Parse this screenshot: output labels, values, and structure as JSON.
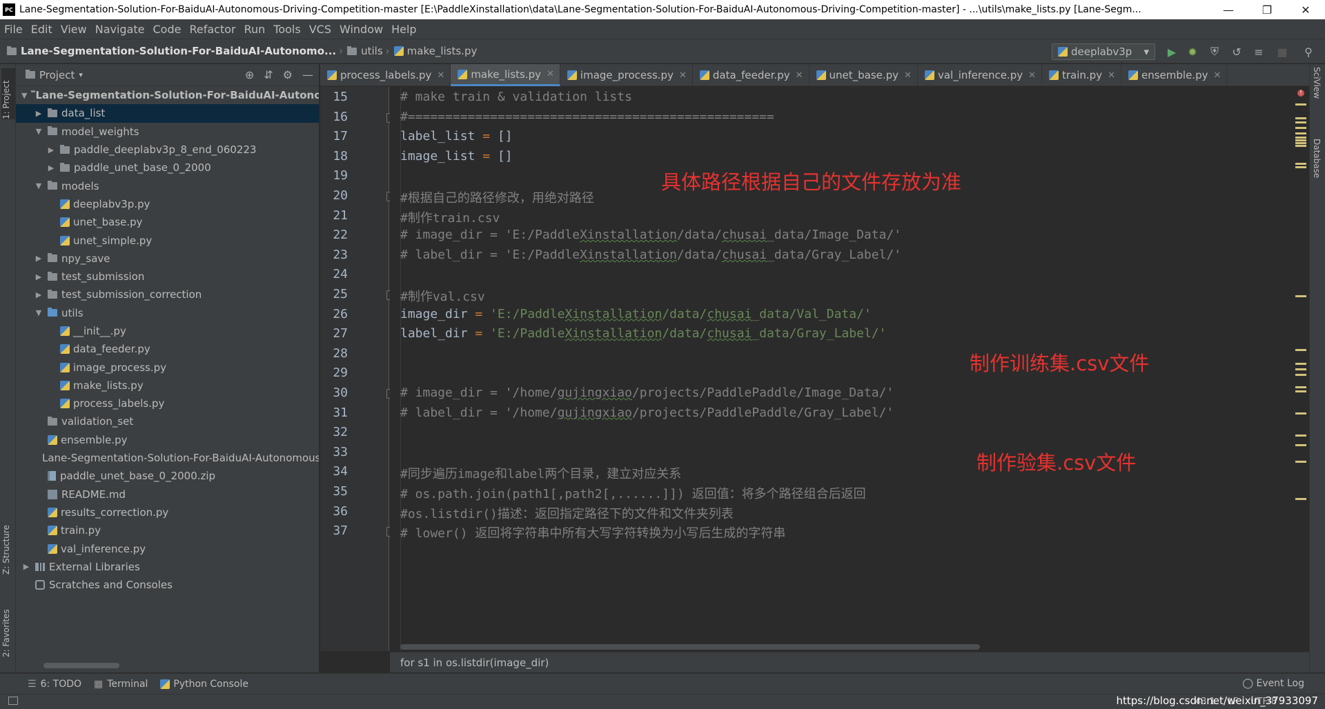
{
  "window": {
    "app_icon": "PC",
    "title": "Lane-Segmentation-Solution-For-BaiduAI-Autonomous-Driving-Competition-master [E:\\PaddleXinstallation\\data\\Lane-Segmentation-Solution-For-BaiduAI-Autonomous-Driving-Competition-master] - ...\\utils\\make_lists.py [Lane-Segm..."
  },
  "menu": [
    "File",
    "Edit",
    "View",
    "Navigate",
    "Code",
    "Refactor",
    "Run",
    "Tools",
    "VCS",
    "Window",
    "Help"
  ],
  "navbar": {
    "project": "Lane-Segmentation-Solution-For-BaiduAI-Autonomo...",
    "folder": "utils",
    "file": "make_lists.py",
    "run_config": "deeplabv3p"
  },
  "left_strip": {
    "project_tab": "1: Project",
    "structure_tab": "Z: Structure",
    "favorites_tab": "2: Favorites"
  },
  "right_strip": {
    "sciview_tab": "SciView",
    "database_tab": "Database"
  },
  "project_panel": {
    "header": "Project",
    "tree": [
      {
        "label": "Lane-Segmentation-Solution-For-BaiduAI-Autonomous-Driving-Competition-master",
        "icon": "folder",
        "level": 0,
        "arrow": "▼",
        "bold": true
      },
      {
        "label": "data_list",
        "icon": "folder",
        "level": 1,
        "arrow": "▶",
        "selected": true
      },
      {
        "label": "model_weights",
        "icon": "folder",
        "level": 1,
        "arrow": "▼"
      },
      {
        "label": "paddle_deeplabv3p_8_end_060223",
        "icon": "folder",
        "level": 2,
        "arrow": "▶"
      },
      {
        "label": "paddle_unet_base_0_2000",
        "icon": "folder",
        "level": 2,
        "arrow": "▶"
      },
      {
        "label": "models",
        "icon": "folder",
        "level": 1,
        "arrow": "▼"
      },
      {
        "label": "deeplabv3p.py",
        "icon": "py",
        "level": 2,
        "arrow": ""
      },
      {
        "label": "unet_base.py",
        "icon": "py",
        "level": 2,
        "arrow": ""
      },
      {
        "label": "unet_simple.py",
        "icon": "py",
        "level": 2,
        "arrow": ""
      },
      {
        "label": "npy_save",
        "icon": "folder",
        "level": 1,
        "arrow": "▶"
      },
      {
        "label": "test_submission",
        "icon": "folder",
        "level": 1,
        "arrow": "▶"
      },
      {
        "label": "test_submission_correction",
        "icon": "folder",
        "level": 1,
        "arrow": "▶"
      },
      {
        "label": "utils",
        "icon": "folder-blue",
        "level": 1,
        "arrow": "▼"
      },
      {
        "label": "__init__.py",
        "icon": "py",
        "level": 2,
        "arrow": ""
      },
      {
        "label": "data_feeder.py",
        "icon": "py",
        "level": 2,
        "arrow": ""
      },
      {
        "label": "image_process.py",
        "icon": "py",
        "level": 2,
        "arrow": ""
      },
      {
        "label": "make_lists.py",
        "icon": "py",
        "level": 2,
        "arrow": ""
      },
      {
        "label": "process_labels.py",
        "icon": "py",
        "level": 2,
        "arrow": ""
      },
      {
        "label": "validation_set",
        "icon": "folder",
        "level": 1,
        "arrow": ""
      },
      {
        "label": "ensemble.py",
        "icon": "py",
        "level": 1,
        "arrow": ""
      },
      {
        "label": "Lane-Segmentation-Solution-For-BaiduAI-Autonomous-Driving-Competition-master.iml",
        "icon": "file",
        "level": 1,
        "arrow": ""
      },
      {
        "label": "paddle_unet_base_0_2000.zip",
        "icon": "zip",
        "level": 1,
        "arrow": ""
      },
      {
        "label": "README.md",
        "icon": "md",
        "level": 1,
        "arrow": ""
      },
      {
        "label": "results_correction.py",
        "icon": "py",
        "level": 1,
        "arrow": ""
      },
      {
        "label": "train.py",
        "icon": "py",
        "level": 1,
        "arrow": ""
      },
      {
        "label": "val_inference.py",
        "icon": "py",
        "level": 1,
        "arrow": ""
      },
      {
        "label": "External Libraries",
        "icon": "lib",
        "level": 0,
        "arrow": "▶"
      },
      {
        "label": "Scratches and Consoles",
        "icon": "scratch",
        "level": 0,
        "arrow": ""
      }
    ]
  },
  "tabs": [
    {
      "label": "process_labels.py",
      "active": false
    },
    {
      "label": "make_lists.py",
      "active": true
    },
    {
      "label": "image_process.py",
      "active": false
    },
    {
      "label": "data_feeder.py",
      "active": false
    },
    {
      "label": "unet_base.py",
      "active": false
    },
    {
      "label": "val_inference.py",
      "active": false
    },
    {
      "label": "train.py",
      "active": false
    },
    {
      "label": "ensemble.py",
      "active": false
    }
  ],
  "editor": {
    "lines": [
      {
        "n": "15",
        "fold": false,
        "parts": [
          {
            "t": "# make train & validation lists",
            "c": "comment"
          }
        ]
      },
      {
        "n": "16",
        "fold": true,
        "parts": [
          {
            "t": "#=================================================",
            "c": "comment"
          }
        ]
      },
      {
        "n": "17",
        "fold": false,
        "parts": [
          {
            "t": "label_list ",
            "c": "plain"
          },
          {
            "t": "=",
            "c": "op"
          },
          {
            "t": " []",
            "c": "plain"
          }
        ]
      },
      {
        "n": "18",
        "fold": false,
        "parts": [
          {
            "t": "image_list ",
            "c": "plain"
          },
          {
            "t": "=",
            "c": "op"
          },
          {
            "t": " []",
            "c": "plain"
          }
        ]
      },
      {
        "n": "19",
        "fold": false,
        "parts": []
      },
      {
        "n": "20",
        "fold": true,
        "parts": [
          {
            "t": "#根据自己的路径修改，用绝对路径",
            "c": "comment"
          }
        ]
      },
      {
        "n": "21",
        "fold": false,
        "parts": [
          {
            "t": "#制作train.csv",
            "c": "comment"
          }
        ]
      },
      {
        "n": "22",
        "fold": false,
        "parts": [
          {
            "t": "# image_dir = 'E:/Paddle",
            "c": "comment"
          },
          {
            "t": "Xinstallation",
            "c": "comment",
            "u": true
          },
          {
            "t": "/data/",
            "c": "comment"
          },
          {
            "t": "chusai",
            "c": "comment",
            "u": true
          },
          {
            "t": "_data/Image_Data/'",
            "c": "comment"
          }
        ]
      },
      {
        "n": "23",
        "fold": false,
        "parts": [
          {
            "t": "# label_dir = 'E:/Paddle",
            "c": "comment"
          },
          {
            "t": "Xinstallation",
            "c": "comment",
            "u": true
          },
          {
            "t": "/data/",
            "c": "comment"
          },
          {
            "t": "chusai",
            "c": "comment",
            "u": true
          },
          {
            "t": "_data/Gray_Label/'",
            "c": "comment"
          }
        ]
      },
      {
        "n": "24",
        "fold": false,
        "parts": []
      },
      {
        "n": "25",
        "fold": true,
        "parts": [
          {
            "t": "#制作val.csv",
            "c": "comment"
          }
        ]
      },
      {
        "n": "26",
        "fold": false,
        "parts": [
          {
            "t": "image_dir ",
            "c": "plain"
          },
          {
            "t": "=",
            "c": "op"
          },
          {
            "t": " 'E:/Paddle",
            "c": "str"
          },
          {
            "t": "Xinstallation",
            "c": "str",
            "u": true
          },
          {
            "t": "/data/",
            "c": "str"
          },
          {
            "t": "chusai",
            "c": "str",
            "u": true
          },
          {
            "t": "_data/Val_Data/'",
            "c": "str"
          }
        ]
      },
      {
        "n": "27",
        "fold": false,
        "parts": [
          {
            "t": "label_dir ",
            "c": "plain"
          },
          {
            "t": "=",
            "c": "op"
          },
          {
            "t": " 'E:/Paddle",
            "c": "str"
          },
          {
            "t": "Xinstallation",
            "c": "str",
            "u": true
          },
          {
            "t": "/data/",
            "c": "str"
          },
          {
            "t": "chusai",
            "c": "str",
            "u": true
          },
          {
            "t": "_data/Gray_Label/'",
            "c": "str"
          }
        ]
      },
      {
        "n": "28",
        "fold": false,
        "parts": []
      },
      {
        "n": "29",
        "fold": false,
        "parts": []
      },
      {
        "n": "30",
        "fold": true,
        "parts": [
          {
            "t": "# image_dir = '/home/",
            "c": "comment"
          },
          {
            "t": "gujingxiao",
            "c": "comment",
            "u": true
          },
          {
            "t": "/projects/PaddlePaddle/Image_Data/'",
            "c": "comment"
          }
        ]
      },
      {
        "n": "31",
        "fold": false,
        "parts": [
          {
            "t": "# label_dir = '/home/",
            "c": "comment"
          },
          {
            "t": "gujingxiao",
            "c": "comment",
            "u": true
          },
          {
            "t": "/projects/PaddlePaddle/Gray_Label/'",
            "c": "comment"
          }
        ]
      },
      {
        "n": "32",
        "fold": false,
        "parts": []
      },
      {
        "n": "33",
        "fold": false,
        "parts": []
      },
      {
        "n": "34",
        "fold": false,
        "parts": [
          {
            "t": "#同步遍历image和label两个目录，建立对应关系",
            "c": "comment"
          }
        ]
      },
      {
        "n": "35",
        "fold": false,
        "parts": [
          {
            "t": "# os.path.join(path1[,path2[,......]]) 返回值：将多个路径组合后返回",
            "c": "comment"
          }
        ]
      },
      {
        "n": "36",
        "fold": false,
        "parts": [
          {
            "t": "#os.listdir()描述：返回指定路径下的文件和文件夹列表",
            "c": "comment"
          }
        ]
      },
      {
        "n": "37",
        "fold": true,
        "parts": [
          {
            "t": "# lower() 返回将字符串中所有大写字符转换为小写后生成的字符串",
            "c": "comment"
          }
        ]
      }
    ],
    "annotations": {
      "path_note": "具体路径根据自己的文件存放为准",
      "train_note": "制作训练集.csv文件",
      "val_note": "制作验集.csv文件"
    },
    "breadcrumb": "for s1 in os.listdir(image_dir)"
  },
  "bottom_tools": {
    "todo": "6: TODO",
    "terminal": "Terminal",
    "python_console": "Python Console",
    "event_log": "Event Log"
  },
  "status": {
    "position": "43:1",
    "line_sep": "LF",
    "encoding": "UTF-8",
    "watermark": "https://blog.csdn.net/weixin_37933097"
  },
  "colors": {
    "annotation_red": "#e6322f",
    "comment": "#808080",
    "string": "#6a8759",
    "keyword_op": "#cc7832",
    "selection": "#0d293e",
    "active_tab_underline": "#4a88c7"
  }
}
